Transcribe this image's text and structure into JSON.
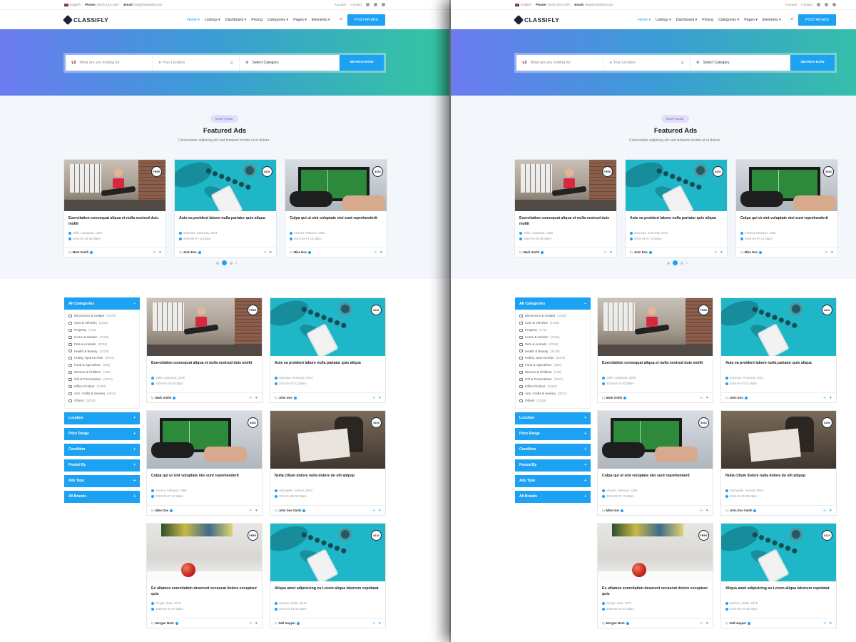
{
  "topbar": {
    "language": "English",
    "phone_label": "Phone:",
    "phone": "(004) 123-1457",
    "email_label": "Email:",
    "email": "help@Classify.com",
    "account": "Account",
    "contact": "Contact"
  },
  "header": {
    "logo": "CLASSIFLY",
    "nav": [
      "Home",
      "Listings",
      "Dashboard",
      "Pricing",
      "Categories",
      "Pages",
      "Elements"
    ],
    "active_nav": "Home",
    "post_button": "POST AN ADS"
  },
  "search": {
    "keyword_placeholder": "What are you looking for",
    "location_placeholder": "Your Location",
    "category_label": "Select Category",
    "button": "SEARCH NOW"
  },
  "featured": {
    "pill": "Most Popular",
    "title": "Featured Ads",
    "subtitle": "Consectetur adipicing elit sed tempore incidnt ut et dolore .",
    "cards": [
      {
        "price": "FREE",
        "title": "Exercitation consequat aliqua et nulla nostrud duis mollit",
        "location": "Valle, Louisiana, 1259",
        "date": "2019-03-19 03:08pm",
        "author": "Mark Smith",
        "art": "gym"
      },
      {
        "price": "$292",
        "title": "Aute ea proident labore nulla pariatur quis aliqua",
        "location": "Seymour, Kentucky, 2014",
        "date": "2019-04-07 11:05pm",
        "author": "John Doe",
        "art": "cyan"
      },
      {
        "price": "$354",
        "title": "Culpa qui ut sint voluptate nisi sunt reprehenderit",
        "location": "Vincent, Missouri, 1556",
        "date": "2019-03-07 12:26pm",
        "author": "Mika Doe",
        "art": "tv"
      }
    ]
  },
  "sidebar": {
    "categories_title": "All Categories",
    "categories": [
      {
        "name": "Electronics & Gedget",
        "count": "(1029)"
      },
      {
        "name": "Cars & Vehicles",
        "count": "(1228)"
      },
      {
        "name": "Property",
        "count": "(178)"
      },
      {
        "name": "Home & Garden",
        "count": "(7163)"
      },
      {
        "name": "Pets & Animals",
        "count": "(8766)"
      },
      {
        "name": "Health & Beauty",
        "count": "(3129)"
      },
      {
        "name": "Hobby, Sport & Kids",
        "count": "(2019)"
      },
      {
        "name": "Food & Agriculture",
        "count": "(323)"
      },
      {
        "name": "Women & Children",
        "count": "(425)"
      },
      {
        "name": "Gift & Presentation",
        "count": "(3223)"
      },
      {
        "name": "Office Product",
        "count": "(3283)"
      },
      {
        "name": "Arts, Crafts & Sewing",
        "count": "(3521)"
      },
      {
        "name": "Others",
        "count": "(3129)"
      }
    ],
    "filters": [
      "Location",
      "Price Range",
      "Condition",
      "Posted By",
      "Ads Type",
      "All Brands"
    ]
  },
  "listings": [
    {
      "price": "FREE",
      "title": "Exercitation consequat aliqua et nulla nostrud duis mollit",
      "location": "Valle, Louisiana, 1259",
      "date": "2019-03-19 03:08pm",
      "author": "Mark Smith",
      "art": "gym"
    },
    {
      "price": "$292",
      "title": "Aute ea proident labore nulla pariatur quis aliqua",
      "location": "Seymour, Kentucky, 2014",
      "date": "2019-04-07 11:05pm",
      "author": "John Doe",
      "art": "cyan"
    },
    {
      "price": "$354",
      "title": "Culpa qui ut sint voluptate nisi sunt reprehenderit",
      "location": "Vincent, Missouri, 1556",
      "date": "2019-03-07 12:26pm",
      "author": "Mike Doe",
      "art": "tv"
    },
    {
      "price": "$159",
      "title": "Nulla cillum dolore nulla dolore do elit aliquip",
      "location": "Springville, Arizona, 8624",
      "date": "2019-01-05 06:28pm",
      "author": "John Doe Smith",
      "art": "artist"
    },
    {
      "price": "FREE",
      "title": "Ex ullamco exercitation deserunt occaecat dolore excepteur quis",
      "location": "Ginger, Iowa, 1076",
      "date": "2019-02-01 07:23pm",
      "author": "Morgan Mark",
      "art": "apple"
    },
    {
      "price": "$120",
      "title": "Aliqua amet adipisicing eu Lorem aliqua laborum cupidatat",
      "location": "Sanford, Idaho, 6419",
      "date": "2019-03-04 03:23pm",
      "author": "Nell Hopper",
      "art": "cyan"
    }
  ],
  "colors": {
    "accent": "#1da1f2",
    "dark": "#1c2431",
    "hero_start": "#6b7bf0",
    "hero_end": "#34c6a0"
  }
}
